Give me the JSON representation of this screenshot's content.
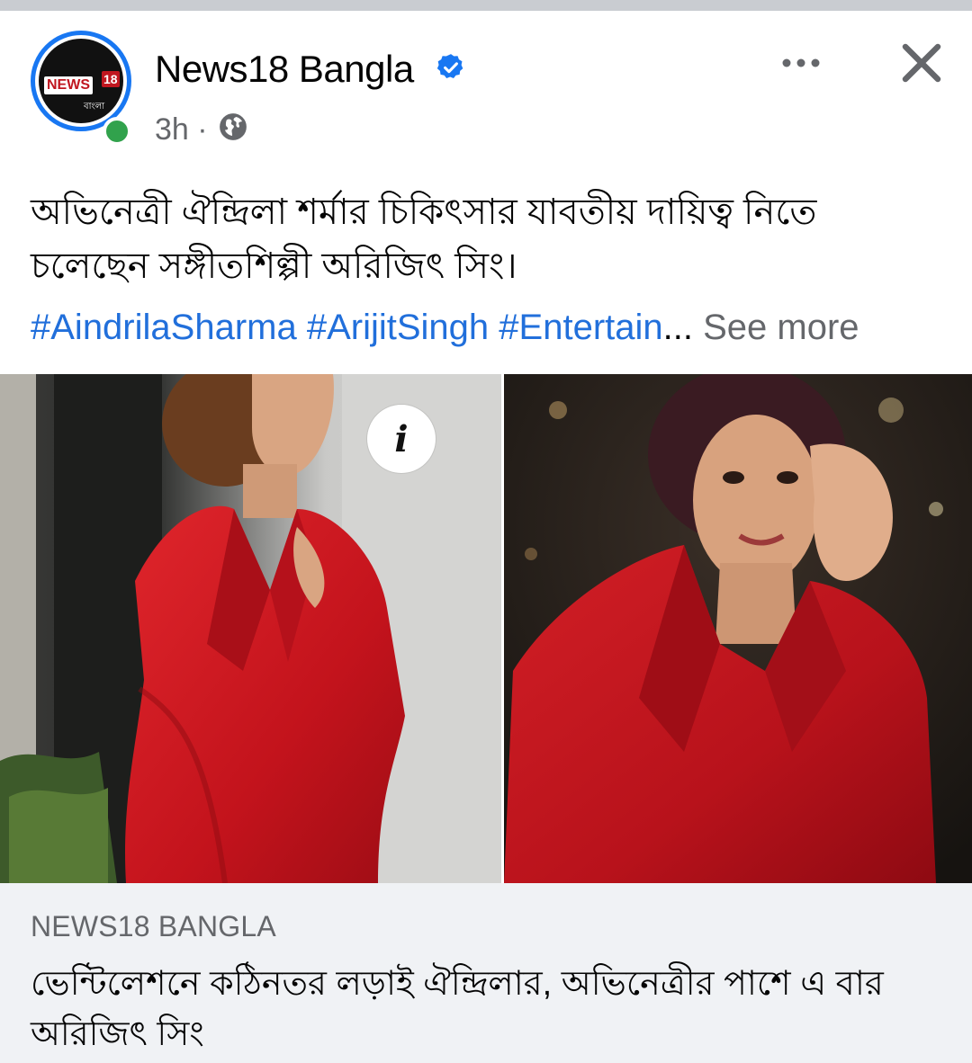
{
  "post": {
    "page_name": "News18 Bangla",
    "avatar_logo": {
      "brand": "NEWS",
      "number": "18",
      "sub": "বাংলা"
    },
    "time": "3h",
    "separator": "·",
    "caption": "অভিনেত্রী ঐন্দ্রিলা শর্মার চিকিৎসার যাবতীয় দায়িত্ব নিতে চলেছেন সঙ্গীতশিল্পী অরিজিৎ সিং।",
    "hashtags": [
      "#AindrilaSharma",
      "#ArijitSingh",
      "#Entertain"
    ],
    "truncation": "...",
    "see_more": "See more",
    "info_glyph": "i"
  },
  "link_preview": {
    "domain": "NEWS18 BANGLA",
    "title": "ভেন্টিলেশনে কঠিনতর লড়াই ঐন্দ্রিলার, অভিনেত্রীর পাশে এ বার অরিজিৎ সিং"
  },
  "icons": {
    "verified": "verified-badge-icon",
    "audience": "globe-icon",
    "more": "more-options-icon",
    "close": "close-icon",
    "info": "info-icon"
  },
  "colors": {
    "accent": "#1877f2",
    "hashtag": "#216fdb",
    "secondary_text": "#65676b",
    "online": "#31a24c",
    "link_bg": "#f0f2f5",
    "dress_red": "#c8141e"
  }
}
